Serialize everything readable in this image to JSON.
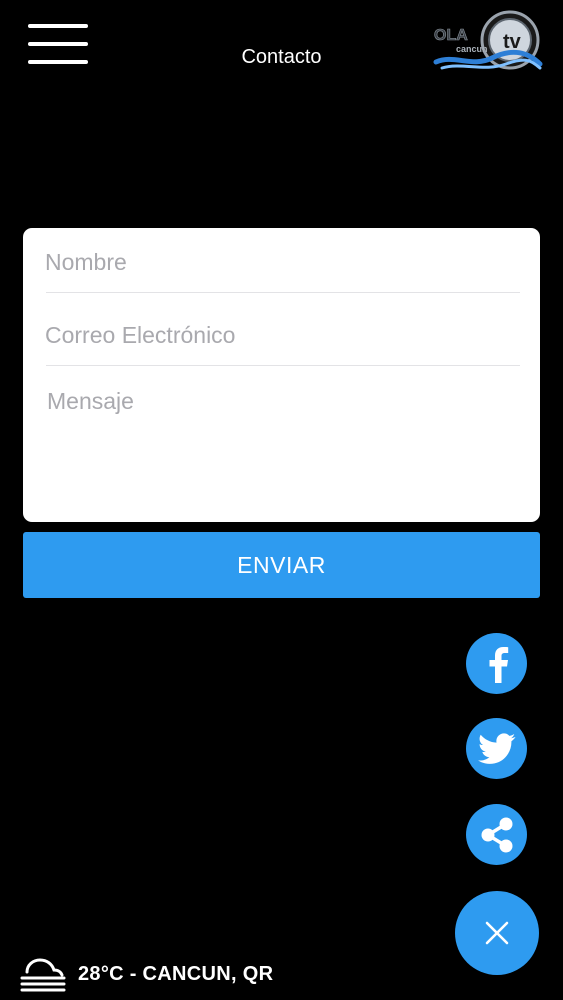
{
  "header": {
    "title": "Contacto",
    "menu_icon": "hamburger-menu-icon",
    "logo_icon": "ola-cancun-tv-logo"
  },
  "form": {
    "name_placeholder": "Nombre",
    "email_placeholder": "Correo Electrónico",
    "message_placeholder": "Mensaje",
    "name_value": "",
    "email_value": "",
    "message_value": "",
    "submit_label": "ENVIAR"
  },
  "social": {
    "facebook_icon": "facebook-icon",
    "twitter_icon": "twitter-icon",
    "share_icon": "share-icon",
    "close_icon": "close-icon"
  },
  "weather": {
    "icon": "fog-icon",
    "text": "28°C - CANCUN, QR"
  },
  "colors": {
    "background": "#000000",
    "accent": "#2e9bf0",
    "card": "#ffffff",
    "placeholder": "#a9a9ae"
  }
}
